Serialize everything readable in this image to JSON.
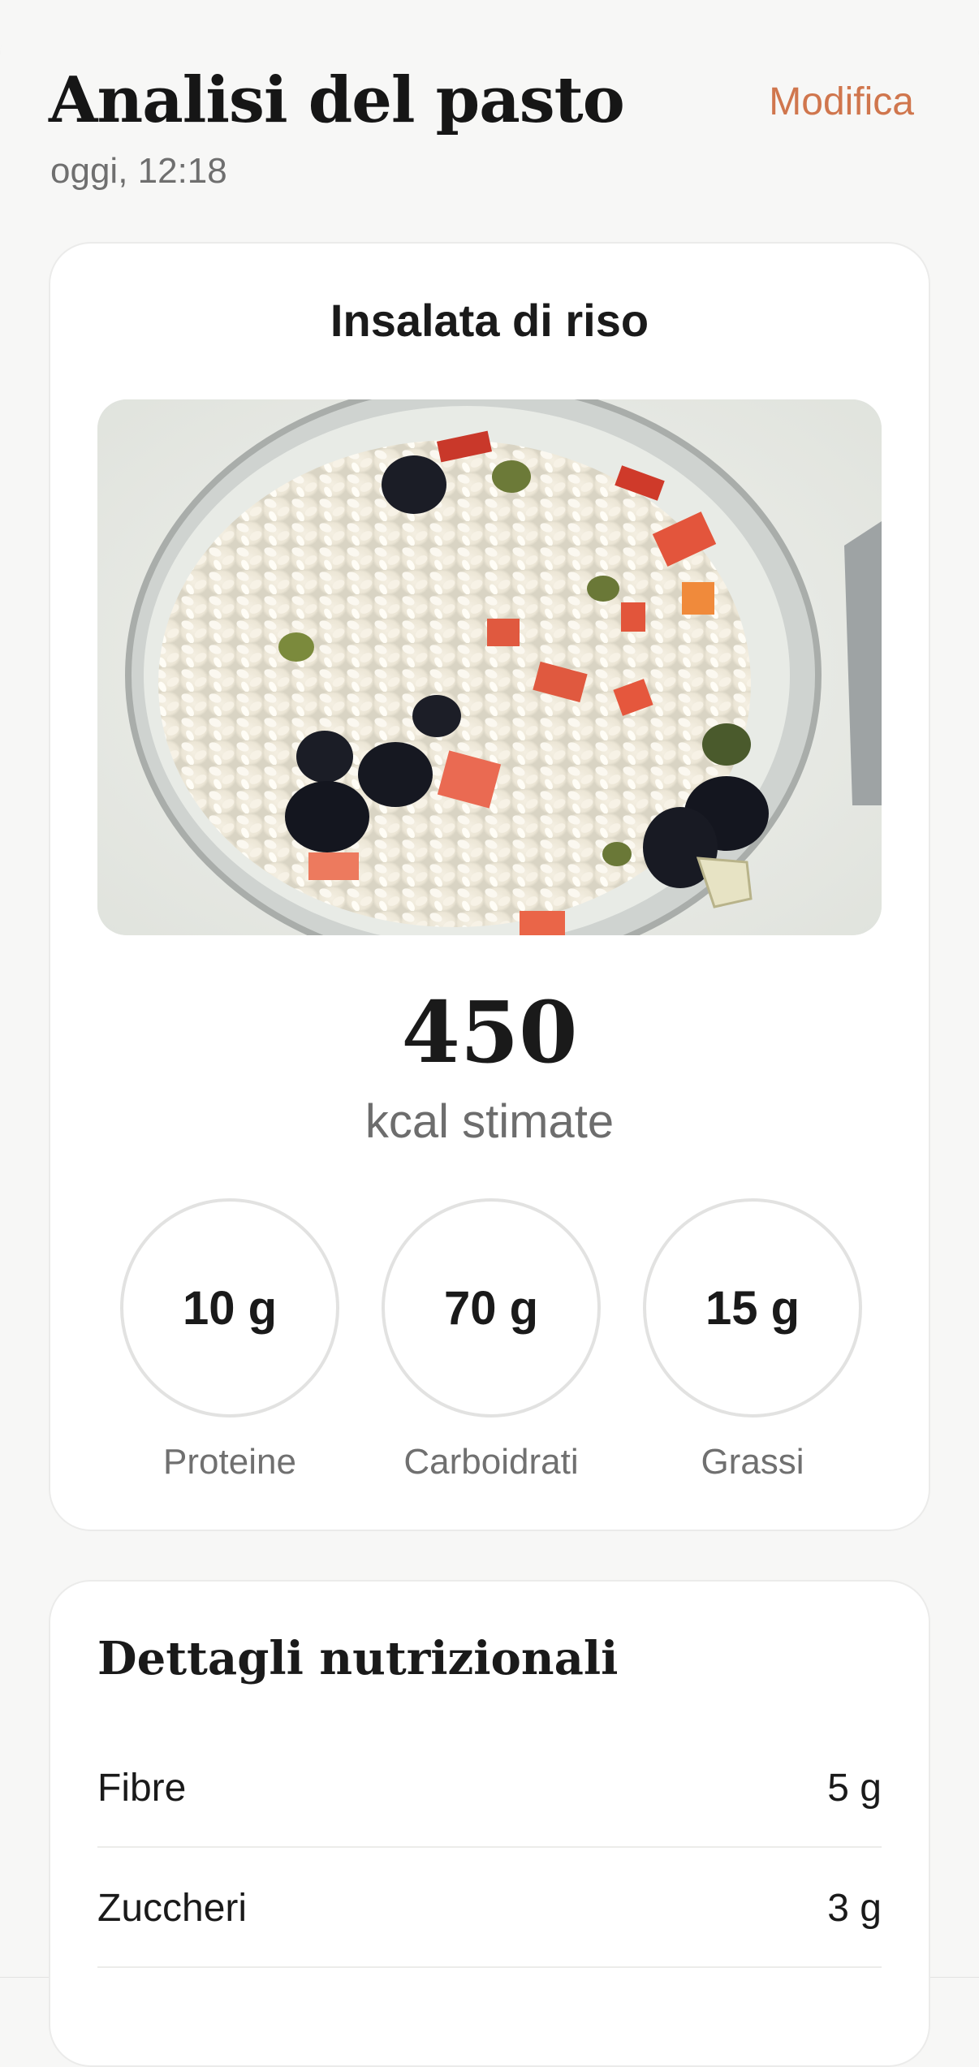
{
  "header": {
    "title": "Analisi del pasto",
    "subtitle": "oggi, 12:18",
    "edit_label": "Modifica"
  },
  "meal": {
    "name": "Insalata di riso",
    "kcal_value": "450",
    "kcal_label": "kcal stimate",
    "macros": [
      {
        "value": "10 g",
        "label": "Proteine"
      },
      {
        "value": "70 g",
        "label": "Carboidrati"
      },
      {
        "value": "15 g",
        "label": "Grassi"
      }
    ]
  },
  "details": {
    "title": "Dettagli nutrizionali",
    "rows": [
      {
        "label": "Fibre",
        "value": "5 g"
      },
      {
        "label": "Zuccheri",
        "value": "3 g"
      }
    ]
  },
  "colors": {
    "accent": "#d0764d",
    "background": "#f7f7f6",
    "card": "#ffffff"
  }
}
